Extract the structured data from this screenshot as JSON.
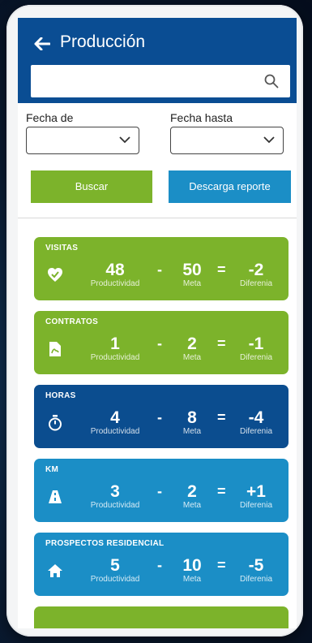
{
  "header": {
    "title": "Producción",
    "search": {
      "value": "",
      "placeholder": ""
    }
  },
  "filters": {
    "fecha_de": {
      "label": "Fecha de",
      "value": ""
    },
    "fecha_hasta": {
      "label": "Fecha hasta",
      "value": ""
    }
  },
  "buttons": {
    "buscar": "Buscar",
    "descarga": "Descarga reporte"
  },
  "labels": {
    "productividad": "Productividad",
    "meta": "Meta",
    "diferencia": "Diferenia"
  },
  "cards": [
    {
      "title": "VISITAS",
      "icon": "verified-heart-icon",
      "productividad": "48",
      "meta": "50",
      "diferencia": "-2",
      "color": "#7cb32b"
    },
    {
      "title": "CONTRATOS",
      "icon": "document-icon",
      "productividad": "1",
      "meta": "2",
      "diferencia": "-1",
      "color": "#7cb32b"
    },
    {
      "title": "HORAS",
      "icon": "stopwatch-icon",
      "productividad": "4",
      "meta": "8",
      "diferencia": "-4",
      "color": "#0b4d8f"
    },
    {
      "title": "KM",
      "icon": "road-icon",
      "productividad": "3",
      "meta": "2",
      "diferencia": "+1",
      "color": "#1b8ec6"
    },
    {
      "title": "PROSPECTOS RESIDENCIAL",
      "icon": "home-icon",
      "productividad": "5",
      "meta": "10",
      "diferencia": "-5",
      "color": "#1b8ec6"
    }
  ],
  "colors": {
    "header": "#0a4d93",
    "green": "#7cb32b",
    "blue": "#1b8ec6",
    "navy": "#0b4d8f"
  }
}
